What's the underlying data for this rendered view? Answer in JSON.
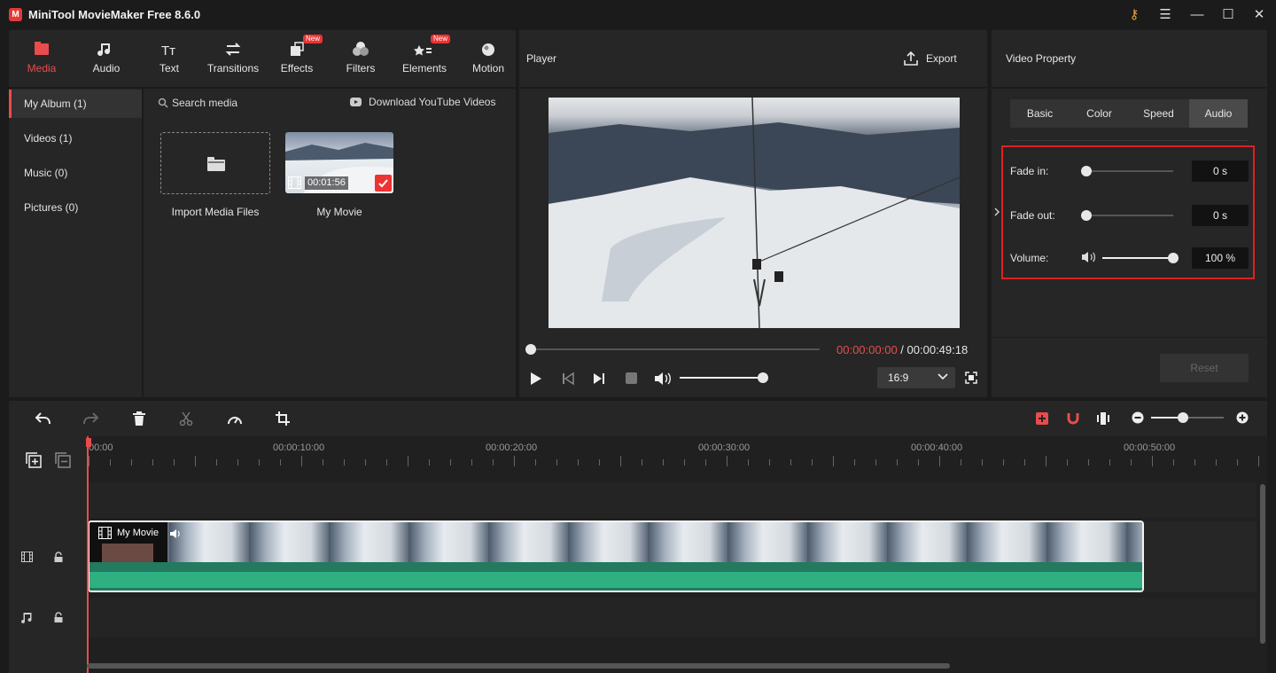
{
  "app": {
    "title": "MiniTool MovieMaker Free 8.6.0",
    "logo_letter": "M"
  },
  "tabs": [
    {
      "label": "Media",
      "icon": "media-folder-icon",
      "active": true
    },
    {
      "label": "Audio",
      "icon": "music-note-icon"
    },
    {
      "label": "Text",
      "icon": "text-icon"
    },
    {
      "label": "Transitions",
      "icon": "transitions-icon"
    },
    {
      "label": "Effects",
      "icon": "effects-icon",
      "badge": "New"
    },
    {
      "label": "Filters",
      "icon": "filters-icon"
    },
    {
      "label": "Elements",
      "icon": "elements-icon",
      "badge": "New"
    },
    {
      "label": "Motion",
      "icon": "motion-icon"
    }
  ],
  "sidebar": {
    "items": [
      {
        "label": "My Album (1)"
      },
      {
        "label": "Videos (1)"
      },
      {
        "label": "Music (0)"
      },
      {
        "label": "Pictures (0)"
      }
    ]
  },
  "media": {
    "search_placeholder": "Search media",
    "download_label": "Download YouTube Videos",
    "import_label": "Import Media Files",
    "clip_name": "My Movie",
    "clip_duration": "00:01:56"
  },
  "player": {
    "title": "Player",
    "export_label": "Export",
    "current_time": "00:00:00:00",
    "separator": " / ",
    "total_time": "00:00:49:18",
    "aspect": "16:9",
    "progress": 0,
    "volume": 1.0
  },
  "property": {
    "title": "Video Property",
    "tabs": [
      "Basic",
      "Color",
      "Speed",
      "Audio"
    ],
    "active_tab": "Audio",
    "fade_in_label": "Fade in:",
    "fade_in_value": "0 s",
    "fade_out_label": "Fade out:",
    "fade_out_value": "0 s",
    "volume_label": "Volume:",
    "volume_value": "100 %",
    "reset_label": "Reset"
  },
  "timeline": {
    "ruler_labels": [
      "00:00",
      "00:00:10:00",
      "00:00:20:00",
      "00:00:30:00",
      "00:00:40:00",
      "00:00:50:00"
    ],
    "clip_label": "My Movie"
  },
  "colors": {
    "accent": "#e84c4c",
    "audio_wave": "#2fb083",
    "highlight_border": "#e02020"
  }
}
